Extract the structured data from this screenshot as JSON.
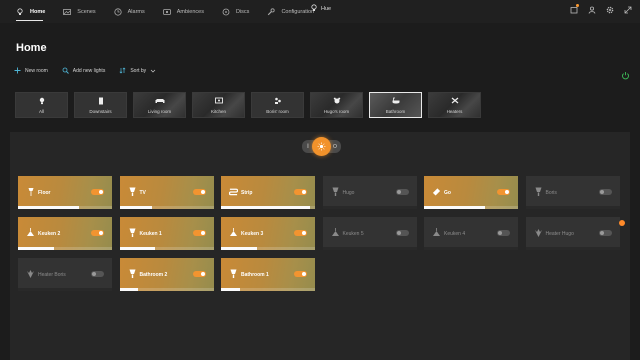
{
  "app": {
    "title": "Hue"
  },
  "nav": [
    {
      "label": "Home",
      "icon": "bulb-icon",
      "active": true
    },
    {
      "label": "Scenes",
      "icon": "scenes-icon",
      "active": false
    },
    {
      "label": "Alarms",
      "icon": "clock-icon",
      "active": false
    },
    {
      "label": "Ambiences",
      "icon": "ambience-icon",
      "active": false
    },
    {
      "label": "Discs",
      "icon": "disc-icon",
      "active": false
    },
    {
      "label": "Configuration",
      "icon": "wrench-icon",
      "active": false
    }
  ],
  "page": {
    "title": "Home"
  },
  "actions": {
    "new_room": "New room",
    "add_lights": "Add new lights",
    "sort_by": "Sort by"
  },
  "rooms": [
    {
      "label": "All",
      "icon": "bulb-icon",
      "selected": false,
      "image": false
    },
    {
      "label": "Downstairs",
      "icon": "door-icon",
      "selected": false,
      "image": false
    },
    {
      "label": "Living room",
      "icon": "sofa-icon",
      "selected": false,
      "image": true
    },
    {
      "label": "Kitchen",
      "icon": "kitchen-icon",
      "selected": false,
      "image": true
    },
    {
      "label": "Boris' room",
      "icon": "kids-icon",
      "selected": false,
      "image": false
    },
    {
      "label": "Hugo's room",
      "icon": "bear-icon",
      "selected": false,
      "image": true
    },
    {
      "label": "Bathroom",
      "icon": "bath-icon",
      "selected": true,
      "image": true
    },
    {
      "label": "Heaters",
      "icon": "heater-icon",
      "selected": false,
      "image": true
    }
  ],
  "master_toggle": {
    "off_label": "I",
    "on_label": "O"
  },
  "lights": [
    {
      "name": "Floor",
      "on": true,
      "brightness": 0.65,
      "icon": "floor-lamp-icon"
    },
    {
      "name": "TV",
      "on": true,
      "brightness": 0.35,
      "icon": "spot-icon"
    },
    {
      "name": "Strip",
      "on": true,
      "brightness": 0.95,
      "icon": "strip-icon"
    },
    {
      "name": "Hugo",
      "on": false,
      "brightness": 0,
      "icon": "spot-icon"
    },
    {
      "name": "Go",
      "on": true,
      "brightness": 0.65,
      "icon": "go-icon"
    },
    {
      "name": "Boris",
      "on": false,
      "brightness": 0,
      "icon": "spot-icon"
    },
    {
      "name": "Keuken 2",
      "on": true,
      "brightness": 0.38,
      "icon": "pendant-icon"
    },
    {
      "name": "Keuken 1",
      "on": true,
      "brightness": 0.38,
      "icon": "spot-icon"
    },
    {
      "name": "Keuken 3",
      "on": true,
      "brightness": 0.38,
      "icon": "pendant-icon"
    },
    {
      "name": "Keuken 5",
      "on": false,
      "brightness": 0,
      "icon": "pendant-icon"
    },
    {
      "name": "Keuken 4",
      "on": false,
      "brightness": 0,
      "icon": "pendant-icon"
    },
    {
      "name": "Heater Hugo",
      "on": false,
      "brightness": 0,
      "icon": "plug-icon"
    },
    {
      "name": "Heater Boris",
      "on": false,
      "brightness": 0,
      "icon": "plug-icon"
    },
    {
      "name": "Bathroom 2",
      "on": true,
      "brightness": 0.2,
      "icon": "spot-icon"
    },
    {
      "name": "Bathroom 1",
      "on": true,
      "brightness": 0.2,
      "icon": "spot-icon"
    }
  ],
  "colors": {
    "accent": "#f2922b",
    "tile_off": "#333333",
    "background": "#1c1c1c"
  }
}
